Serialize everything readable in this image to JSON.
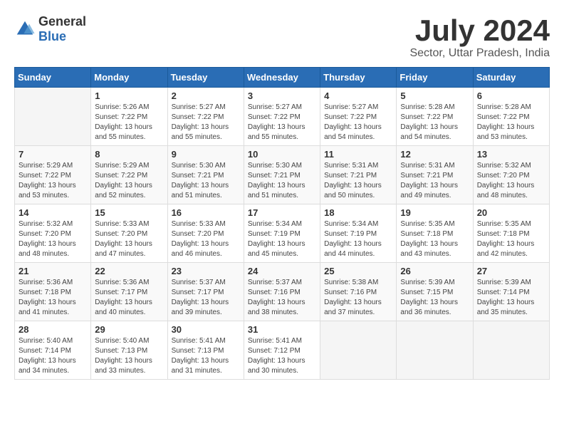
{
  "logo": {
    "general": "General",
    "blue": "Blue"
  },
  "title": "July 2024",
  "subtitle": "Sector, Uttar Pradesh, India",
  "headers": [
    "Sunday",
    "Monday",
    "Tuesday",
    "Wednesday",
    "Thursday",
    "Friday",
    "Saturday"
  ],
  "weeks": [
    [
      {
        "day": "",
        "info": ""
      },
      {
        "day": "1",
        "info": "Sunrise: 5:26 AM\nSunset: 7:22 PM\nDaylight: 13 hours\nand 55 minutes."
      },
      {
        "day": "2",
        "info": "Sunrise: 5:27 AM\nSunset: 7:22 PM\nDaylight: 13 hours\nand 55 minutes."
      },
      {
        "day": "3",
        "info": "Sunrise: 5:27 AM\nSunset: 7:22 PM\nDaylight: 13 hours\nand 55 minutes."
      },
      {
        "day": "4",
        "info": "Sunrise: 5:27 AM\nSunset: 7:22 PM\nDaylight: 13 hours\nand 54 minutes."
      },
      {
        "day": "5",
        "info": "Sunrise: 5:28 AM\nSunset: 7:22 PM\nDaylight: 13 hours\nand 54 minutes."
      },
      {
        "day": "6",
        "info": "Sunrise: 5:28 AM\nSunset: 7:22 PM\nDaylight: 13 hours\nand 53 minutes."
      }
    ],
    [
      {
        "day": "7",
        "info": "Sunrise: 5:29 AM\nSunset: 7:22 PM\nDaylight: 13 hours\nand 53 minutes."
      },
      {
        "day": "8",
        "info": "Sunrise: 5:29 AM\nSunset: 7:22 PM\nDaylight: 13 hours\nand 52 minutes."
      },
      {
        "day": "9",
        "info": "Sunrise: 5:30 AM\nSunset: 7:21 PM\nDaylight: 13 hours\nand 51 minutes."
      },
      {
        "day": "10",
        "info": "Sunrise: 5:30 AM\nSunset: 7:21 PM\nDaylight: 13 hours\nand 51 minutes."
      },
      {
        "day": "11",
        "info": "Sunrise: 5:31 AM\nSunset: 7:21 PM\nDaylight: 13 hours\nand 50 minutes."
      },
      {
        "day": "12",
        "info": "Sunrise: 5:31 AM\nSunset: 7:21 PM\nDaylight: 13 hours\nand 49 minutes."
      },
      {
        "day": "13",
        "info": "Sunrise: 5:32 AM\nSunset: 7:20 PM\nDaylight: 13 hours\nand 48 minutes."
      }
    ],
    [
      {
        "day": "14",
        "info": "Sunrise: 5:32 AM\nSunset: 7:20 PM\nDaylight: 13 hours\nand 48 minutes."
      },
      {
        "day": "15",
        "info": "Sunrise: 5:33 AM\nSunset: 7:20 PM\nDaylight: 13 hours\nand 47 minutes."
      },
      {
        "day": "16",
        "info": "Sunrise: 5:33 AM\nSunset: 7:20 PM\nDaylight: 13 hours\nand 46 minutes."
      },
      {
        "day": "17",
        "info": "Sunrise: 5:34 AM\nSunset: 7:19 PM\nDaylight: 13 hours\nand 45 minutes."
      },
      {
        "day": "18",
        "info": "Sunrise: 5:34 AM\nSunset: 7:19 PM\nDaylight: 13 hours\nand 44 minutes."
      },
      {
        "day": "19",
        "info": "Sunrise: 5:35 AM\nSunset: 7:18 PM\nDaylight: 13 hours\nand 43 minutes."
      },
      {
        "day": "20",
        "info": "Sunrise: 5:35 AM\nSunset: 7:18 PM\nDaylight: 13 hours\nand 42 minutes."
      }
    ],
    [
      {
        "day": "21",
        "info": "Sunrise: 5:36 AM\nSunset: 7:18 PM\nDaylight: 13 hours\nand 41 minutes."
      },
      {
        "day": "22",
        "info": "Sunrise: 5:36 AM\nSunset: 7:17 PM\nDaylight: 13 hours\nand 40 minutes."
      },
      {
        "day": "23",
        "info": "Sunrise: 5:37 AM\nSunset: 7:17 PM\nDaylight: 13 hours\nand 39 minutes."
      },
      {
        "day": "24",
        "info": "Sunrise: 5:37 AM\nSunset: 7:16 PM\nDaylight: 13 hours\nand 38 minutes."
      },
      {
        "day": "25",
        "info": "Sunrise: 5:38 AM\nSunset: 7:16 PM\nDaylight: 13 hours\nand 37 minutes."
      },
      {
        "day": "26",
        "info": "Sunrise: 5:39 AM\nSunset: 7:15 PM\nDaylight: 13 hours\nand 36 minutes."
      },
      {
        "day": "27",
        "info": "Sunrise: 5:39 AM\nSunset: 7:14 PM\nDaylight: 13 hours\nand 35 minutes."
      }
    ],
    [
      {
        "day": "28",
        "info": "Sunrise: 5:40 AM\nSunset: 7:14 PM\nDaylight: 13 hours\nand 34 minutes."
      },
      {
        "day": "29",
        "info": "Sunrise: 5:40 AM\nSunset: 7:13 PM\nDaylight: 13 hours\nand 33 minutes."
      },
      {
        "day": "30",
        "info": "Sunrise: 5:41 AM\nSunset: 7:13 PM\nDaylight: 13 hours\nand 31 minutes."
      },
      {
        "day": "31",
        "info": "Sunrise: 5:41 AM\nSunset: 7:12 PM\nDaylight: 13 hours\nand 30 minutes."
      },
      {
        "day": "",
        "info": ""
      },
      {
        "day": "",
        "info": ""
      },
      {
        "day": "",
        "info": ""
      }
    ]
  ]
}
